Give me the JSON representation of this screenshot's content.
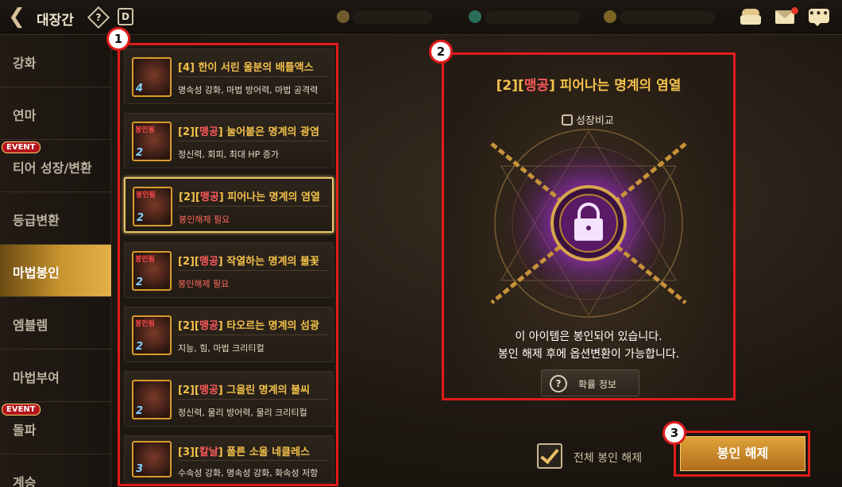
{
  "header": {
    "back_icon": "arrow-left-icon",
    "title": "대장간",
    "help_icon": "question-diamond-icon",
    "calendar_icon": "calendar-d-icon",
    "icons": [
      "bag-icon",
      "mail-icon",
      "chat-icon"
    ]
  },
  "sidebar": {
    "items": [
      {
        "label": "강화",
        "event": false,
        "active": false
      },
      {
        "label": "연마",
        "event": false,
        "active": false
      },
      {
        "label": "티어 성장/변환",
        "event": true,
        "active": false
      },
      {
        "label": "등급변환",
        "event": false,
        "active": false
      },
      {
        "label": "마법봉인",
        "event": false,
        "active": true
      },
      {
        "label": "엠블렘",
        "event": false,
        "active": false
      },
      {
        "label": "마법부여",
        "event": false,
        "active": false
      },
      {
        "label": "돌파",
        "event": true,
        "active": false
      },
      {
        "label": "계승",
        "event": false,
        "active": false
      }
    ],
    "event_badge": "EVENT"
  },
  "list": {
    "items": [
      {
        "prefix": "[4] ",
        "keyword": "",
        "name": "한이 서린 울분의 배틀액스",
        "sub": "명속성 강화, 마법 방어력, 마법 공격력",
        "sealed": false,
        "tier": "4"
      },
      {
        "prefix": "[2][",
        "keyword": "맹공",
        "name": "] 눌어붙은 명계의 광염",
        "sub": "정신력, 회피, 최대 HP 증가",
        "sealed": false,
        "tier": "2"
      },
      {
        "prefix": "[2][",
        "keyword": "맹공",
        "name": "] 피어나는 명계의 염열",
        "sub": "봉인해제 필요",
        "sealed": true,
        "tier": "2"
      },
      {
        "prefix": "[2][",
        "keyword": "맹공",
        "name": "] 작열하는 명계의 불꽃",
        "sub": "봉인해제 필요",
        "sealed": true,
        "tier": "2"
      },
      {
        "prefix": "[2][",
        "keyword": "맹공",
        "name": "] 타오르는 명계의 섬광",
        "sub": "지능, 힘, 마법 크리티컬",
        "sealed": false,
        "tier": "2"
      },
      {
        "prefix": "[2][",
        "keyword": "맹공",
        "name": "] 그을린 명계의 불씨",
        "sub": "정신력, 물리 방어력, 물리 크리티컬",
        "sealed": false,
        "tier": "2"
      },
      {
        "prefix": "[3][",
        "keyword": "칼날",
        "name": "] 폴른 소울 네클레스",
        "sub": "수속성 강화, 명속성 강화, 화속성 저항",
        "sealed": false,
        "tier": "3"
      }
    ],
    "selected_index": 2,
    "thumb_tag": "봉인됨"
  },
  "detail": {
    "title_prefix": "[2][",
    "title_keyword": "맹공",
    "title_rest": "] 피어나는 명계의 염열",
    "compare_label": "성장비교",
    "message_line1": "이 아이템은 봉인되어 있습니다.",
    "message_line2": "봉인 해제 후에 옵션변환이 가능합니다.",
    "prob_button": "확률 정보",
    "lock_icon": "lock-icon"
  },
  "footer": {
    "select_all_label": "전체 봉인 해제",
    "select_all_checked": true,
    "unseal_button": "봉인 해제"
  },
  "callouts": [
    "1",
    "2",
    "3"
  ],
  "colors": {
    "highlight_red": "#e21b1b",
    "gold_text": "#f2c04a",
    "keyword_red": "#ff5a5a",
    "active_menu": "#c8952e"
  }
}
